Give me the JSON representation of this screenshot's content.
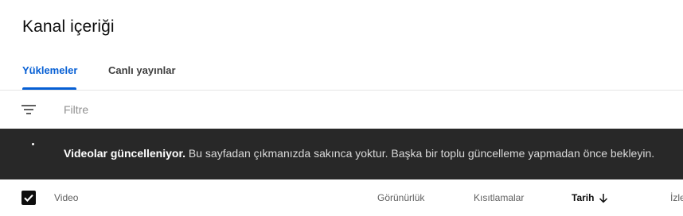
{
  "page": {
    "title": "Kanal içeriği"
  },
  "tabs": [
    {
      "label": "Yüklemeler",
      "active": true
    },
    {
      "label": "Canlı yayınlar",
      "active": false
    }
  ],
  "filter": {
    "placeholder": "Filtre",
    "value": ""
  },
  "banner": {
    "strong": "Videolar güncelleniyor.",
    "message": " Bu sayfadan çıkmanızda sakınca yoktur. Başka bir toplu güncelleme yapmadan önce bekleyin."
  },
  "table": {
    "columns": {
      "video": "Video",
      "visibility": "Görünürlük",
      "restrictions": "Kısıtlamalar",
      "date": "Tarih",
      "views": "İzle"
    },
    "sort": {
      "column": "date",
      "direction": "descending",
      "icon": "arrow-down-icon"
    },
    "select_all_checked": true
  },
  "colors": {
    "accent": "#065fd4",
    "banner_bg": "#282828",
    "text_primary": "#0d0d0d",
    "text_secondary": "#606060"
  }
}
